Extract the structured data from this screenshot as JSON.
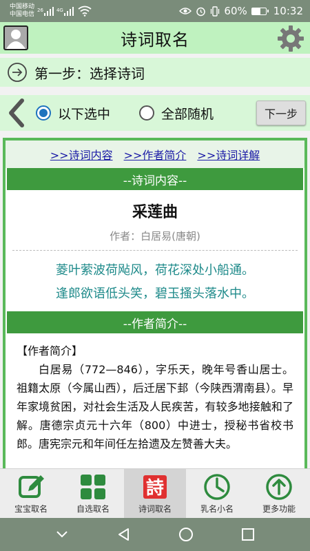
{
  "status": {
    "carrier1": "中国移动",
    "carrier2": "中国电信",
    "sig1_tag": "26",
    "sig2_tag": "4G",
    "battery": "60%",
    "battery_level": 0.6,
    "time": "10:32"
  },
  "header": {
    "title": "诗词取名"
  },
  "step": {
    "label": "第一步：选择诗词"
  },
  "selection": {
    "option1": "以下选中",
    "option2": "全部随机",
    "selected": "option1",
    "next_label": "下一步"
  },
  "links": {
    "content": ">>诗词内容",
    "author": ">>作者简介",
    "detail": ">>诗词详解"
  },
  "poem": {
    "section_title": "--诗词内容--",
    "title": "采莲曲",
    "author": "作者：白居易(唐朝)",
    "lines": [
      "菱叶萦波荷飐风，荷花深处小船通。",
      "逢郎欲语低头笑，碧玉搔头落水中。"
    ]
  },
  "author_bio": {
    "section_title": "--作者简介--",
    "head": "【作者简介】",
    "text": "白居易（772—846），字乐天，晚年号香山居士。祖籍太原（今属山西），后迁居下邽（今陕西渭南县）。早年家境贫困，对社会生活及人民疾苦，有较多地接触和了解。唐德宗贞元十六年（800）中进士，授秘书省校书郎。唐宪宗元和年间任左拾遗及左赞善大夫。"
  },
  "bottom_nav": {
    "items": [
      {
        "label": "宝宝取名",
        "icon": "edit-icon"
      },
      {
        "label": "自选取名",
        "icon": "grid-icon"
      },
      {
        "label": "诗词取名",
        "icon": "poem-icon",
        "icon_text": "詩"
      },
      {
        "label": "乳名小名",
        "icon": "clock-icon"
      },
      {
        "label": "更多功能",
        "icon": "arrow-up-icon"
      }
    ],
    "active_index": 2
  },
  "colors": {
    "header_bg": "#bff2bf",
    "step_bg": "#d8f7d8",
    "section_bar": "#3e9a3e",
    "poem_text": "#1e8a8a",
    "link": "#1a1aa6",
    "icon_green": "#2e8b3e",
    "poem_icon_red": "#e03030"
  }
}
